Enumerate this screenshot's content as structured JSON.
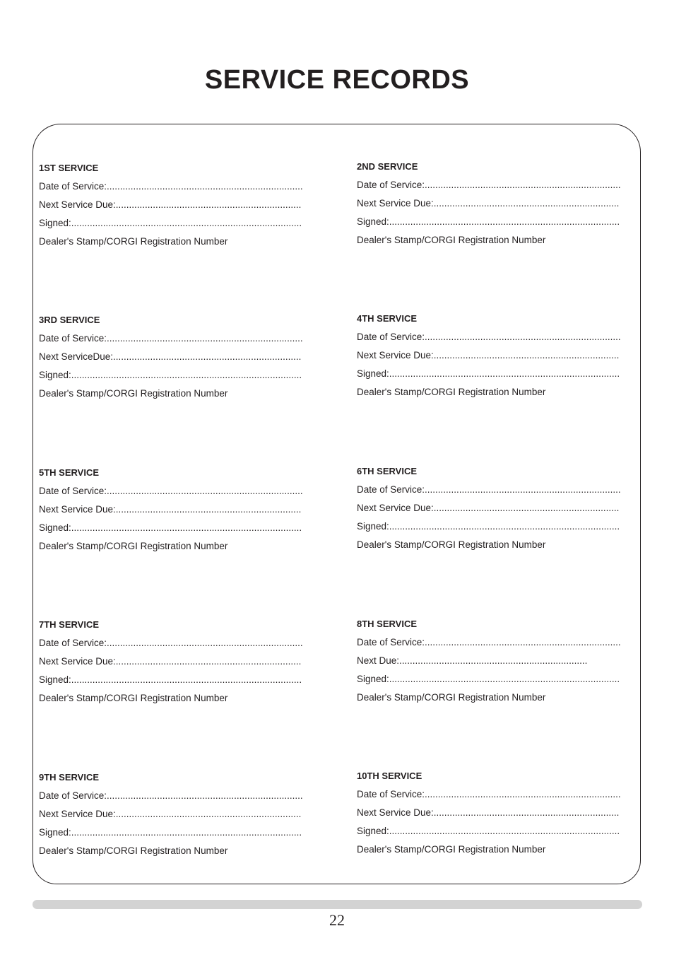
{
  "page": {
    "title": "SERVICE RECORDS",
    "page_number": "22"
  },
  "services": [
    {
      "heading": "1ST SERVICE",
      "date": "Date of Service:..........................................................................",
      "next": "Next Service Due:......................................................................",
      "signed": "Signed:.......................................................................................",
      "stamp": "Dealer's Stamp/CORGI Registration Number"
    },
    {
      "heading": "2ND SERVICE",
      "date": "Date of Service:..........................................................................",
      "next": "Next Service Due:......................................................................",
      "signed": "Signed:.......................................................................................",
      "stamp": "Dealer's Stamp/CORGI Registration Number"
    },
    {
      "heading": "3RD SERVICE",
      "date": "Date of Service:..........................................................................",
      "next": "Next ServiceDue:.......................................................................",
      "signed": "Signed:.......................................................................................",
      "stamp": "Dealer's Stamp/CORGI Registration Number"
    },
    {
      "heading": "4TH SERVICE",
      "date": "Date of Service:..........................................................................",
      "next": "Next Service Due:......................................................................",
      "signed": "Signed:.......................................................................................",
      "stamp": "Dealer's Stamp/CORGI Registration Number"
    },
    {
      "heading": "5TH SERVICE",
      "date": "Date of Service:..........................................................................",
      "next": "Next Service Due:......................................................................",
      "signed": "Signed:.......................................................................................",
      "stamp": "Dealer's Stamp/CORGI Registration Number"
    },
    {
      "heading": "6TH SERVICE",
      "date": "Date of Service:..........................................................................",
      "next": "Next Service Due:......................................................................",
      "signed": "Signed:.......................................................................................",
      "stamp": "Dealer's Stamp/CORGI Registration Number"
    },
    {
      "heading": "7TH SERVICE",
      "date": "Date of Service:..........................................................................",
      "next": "Next Service Due:......................................................................",
      "signed": "Signed:.......................................................................................",
      "stamp": "Dealer's Stamp/CORGI Registration Number"
    },
    {
      "heading": "8TH SERVICE",
      "date": "Date of Service:..........................................................................",
      "next": "Next Due:.......................................................................",
      "signed": "Signed:.......................................................................................",
      "stamp": "Dealer's Stamp/CORGI Registration Number"
    },
    {
      "heading": "9TH SERVICE",
      "date": "Date of Service:..........................................................................",
      "next": "Next Service Due:......................................................................",
      "signed": "Signed:.......................................................................................",
      "stamp": "Dealer's Stamp/CORGI Registration Number"
    },
    {
      "heading": "10TH SERVICE",
      "date": "Date of Service:..........................................................................",
      "next": "Next Service Due:......................................................................",
      "signed": "Signed:.......................................................................................",
      "stamp": "Dealer's Stamp/CORGI Registration Number"
    }
  ]
}
